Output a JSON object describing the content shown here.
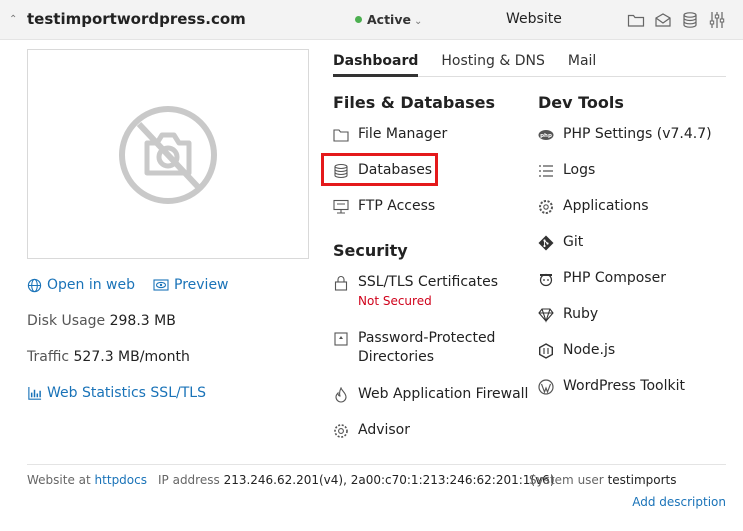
{
  "header": {
    "domain": "testimportwordpress.com",
    "status": "Active",
    "type": "Website",
    "icons": [
      "folder-icon",
      "mail-icon",
      "database-icon",
      "settings-sliders-icon"
    ]
  },
  "preview": {
    "icon": "no-screenshot-camera-icon"
  },
  "left": {
    "open_in_web": "Open in web",
    "preview": "Preview",
    "disk_usage_label": "Disk Usage",
    "disk_usage_value": "298.3 MB",
    "traffic_label": "Traffic",
    "traffic_value": "527.3 MB/month",
    "web_stats": "Web Statistics SSL/TLS"
  },
  "tabs": [
    {
      "label": "Dashboard",
      "active": true
    },
    {
      "label": "Hosting & DNS",
      "active": false
    },
    {
      "label": "Mail",
      "active": false
    }
  ],
  "files": {
    "title": "Files & Databases",
    "items": [
      {
        "label": "File Manager",
        "icon": "folder-icon"
      },
      {
        "label": "Databases",
        "icon": "database-icon"
      },
      {
        "label": "FTP Access",
        "icon": "ftp-icon"
      }
    ]
  },
  "security": {
    "title": "Security",
    "items": [
      {
        "label": "SSL/TLS Certificates",
        "icon": "lock-icon",
        "sub": "Not Secured"
      },
      {
        "label": "Password-Protected",
        "label2": "Directories",
        "icon": "protected-folder-icon"
      },
      {
        "label": "Web Application Firewall",
        "icon": "flame-icon"
      },
      {
        "label": "Advisor",
        "icon": "gear-advisor-icon"
      }
    ]
  },
  "devtools": {
    "title": "Dev Tools",
    "items": [
      {
        "label": "PHP Settings (v7.4.7)",
        "icon": "php-icon"
      },
      {
        "label": "Logs",
        "icon": "list-icon"
      },
      {
        "label": "Applications",
        "icon": "gear-icon"
      },
      {
        "label": "Git",
        "icon": "git-icon"
      },
      {
        "label": "PHP Composer",
        "icon": "composer-icon"
      },
      {
        "label": "Ruby",
        "icon": "ruby-icon"
      },
      {
        "label": "Node.js",
        "icon": "nodejs-icon"
      },
      {
        "label": "WordPress Toolkit",
        "icon": "wordpress-icon"
      }
    ]
  },
  "footer": {
    "website_at_label": "Website at",
    "website_at_value": "httpdocs",
    "ip_label": "IP address",
    "ip_value": "213.246.62.201(v4), 2a00:c70:1:213:246:62:201:1(v6)",
    "system_user_label": "System user",
    "system_user_value": "testimports",
    "add_description": "Add description"
  },
  "colors": {
    "link": "#1a73b8",
    "highlight": "#e4191b",
    "status_active": "#4caf50",
    "warning": "#d0021b"
  }
}
